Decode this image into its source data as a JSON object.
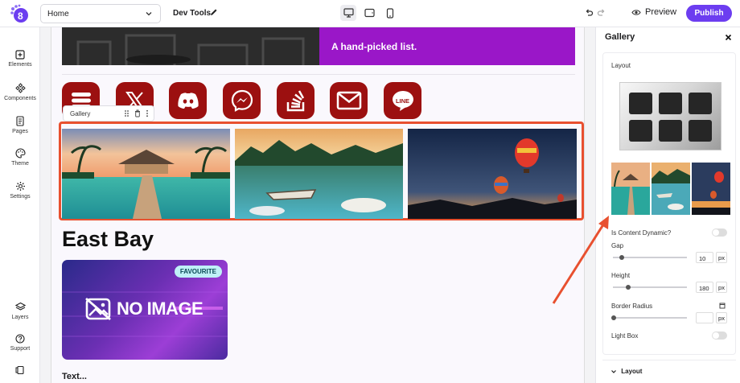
{
  "topbar": {
    "page_select_value": "Home",
    "site_name": "Dev Tools",
    "preview_label": "Preview",
    "publish_label": "Publish"
  },
  "sidebar": {
    "items": [
      {
        "label": "Elements",
        "icon": "plus-square-icon"
      },
      {
        "label": "Components",
        "icon": "components-icon"
      },
      {
        "label": "Pages",
        "icon": "pages-icon"
      },
      {
        "label": "Theme",
        "icon": "palette-icon"
      },
      {
        "label": "Settings",
        "icon": "gear-icon"
      }
    ],
    "bottom_items": [
      {
        "label": "Layers",
        "icon": "layers-icon"
      },
      {
        "label": "Support",
        "icon": "help-icon"
      },
      {
        "label": "",
        "icon": "device-icon"
      }
    ]
  },
  "canvas": {
    "hero_text": "A hand-picked list.",
    "social_icons": [
      "stack-icon",
      "x-icon",
      "discord-icon",
      "messenger-icon",
      "stackoverflow-icon",
      "mail-icon",
      "line-icon"
    ],
    "line_label": "LINE",
    "gallery_label": "Gallery",
    "section_title": "East Bay",
    "card_badge": "FAVOURITE",
    "card_placeholder": "NO IMAGE",
    "text_placeholder": "Text..."
  },
  "panel": {
    "title": "Gallery",
    "layout_label": "Layout",
    "dynamic_label": "Is Content Dynamic?",
    "dynamic_on": false,
    "gap_label": "Gap",
    "gap_value": "10",
    "gap_unit": "px",
    "height_label": "Height",
    "height_value": "180",
    "height_unit": "px",
    "border_radius_label": "Border Radius",
    "border_radius_value": "",
    "border_radius_unit": "px",
    "lightbox_label": "Light Box",
    "lightbox_on": false,
    "layout_section_label": "Layout"
  },
  "colors": {
    "accent": "#6c3df0",
    "hero_purple": "#9a17c8",
    "social_red": "#9c1010",
    "selection": "#e8502f"
  }
}
